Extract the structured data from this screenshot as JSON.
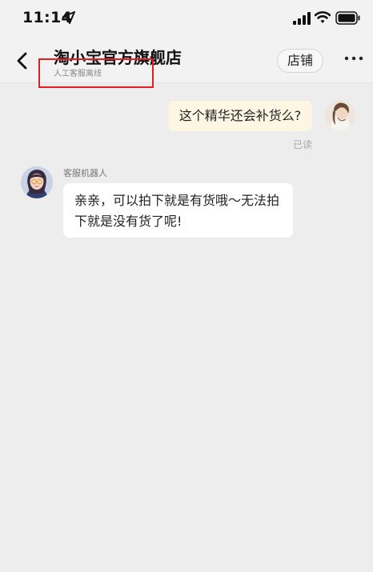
{
  "status_bar": {
    "time": "11:14"
  },
  "header": {
    "shop_name": "淘小宝官方旗舰店",
    "service_status": "人工客服离线",
    "store_button": "店铺"
  },
  "messages": [
    {
      "direction": "outgoing",
      "text": "这个精华还会补货么?",
      "read_status": "已读"
    },
    {
      "direction": "incoming",
      "sender": "客服机器人",
      "lines": [
        "亲亲，可以拍下就是有货哦～无法拍",
        "下就是没有货了呢!"
      ]
    }
  ],
  "colors": {
    "background": "#ededed",
    "outgoing_bubble": "#fdf6e3",
    "incoming_bubble": "#ffffff",
    "highlight": "#e02020"
  },
  "icons": {
    "location": "location-arrow-icon",
    "signal": "cellular-signal-icon",
    "wifi": "wifi-icon",
    "battery": "battery-icon",
    "back": "back-chevron-icon",
    "more": "more-dots-icon"
  }
}
